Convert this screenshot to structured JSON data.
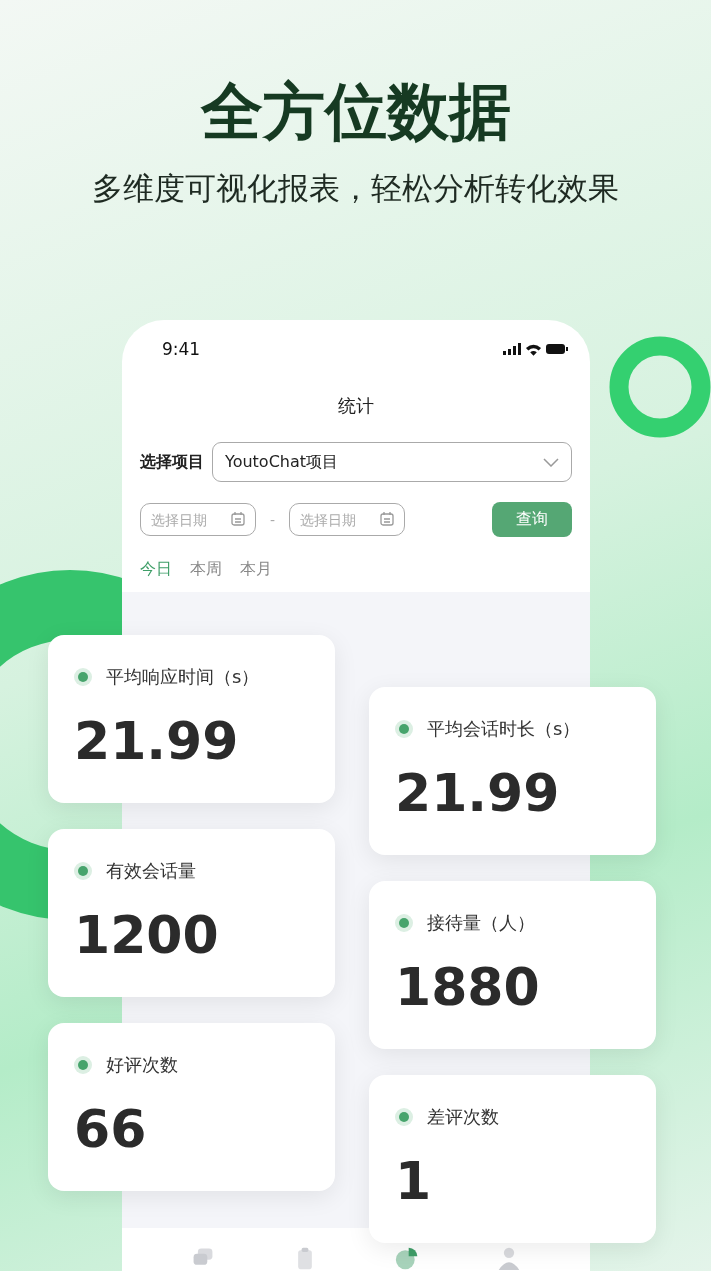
{
  "headline": "全方位数据",
  "subheadline": "多维度可视化报表，轻松分析转化效果",
  "phone": {
    "status_time": "9:41",
    "title": "统计",
    "project_label": "选择项目",
    "project_value": "YoutoChat项目",
    "date_from": {
      "placeholder": "选择日期"
    },
    "date_separator": "-",
    "date_to": {
      "placeholder": "选择日期"
    },
    "query_button": "查询",
    "tabs": [
      {
        "label": "今日",
        "selected": true
      },
      {
        "label": "本周",
        "selected": false
      },
      {
        "label": "本月",
        "selected": false
      }
    ],
    "nav": [
      {
        "kind": "chat",
        "selected": false
      },
      {
        "kind": "clipboard",
        "selected": false
      },
      {
        "kind": "pie",
        "selected": true
      },
      {
        "kind": "person",
        "selected": false
      }
    ]
  },
  "stats": [
    {
      "label": "平均响应时间（s）",
      "value": "21.99"
    },
    {
      "label": "平均会话时长（s）",
      "value": "21.99"
    },
    {
      "label": "有效会话量",
      "value": "1200"
    },
    {
      "label": "接待量（人）",
      "value": "1880"
    },
    {
      "label": "好评次数",
      "value": "66"
    },
    {
      "label": "差评次数",
      "value": "1"
    }
  ]
}
